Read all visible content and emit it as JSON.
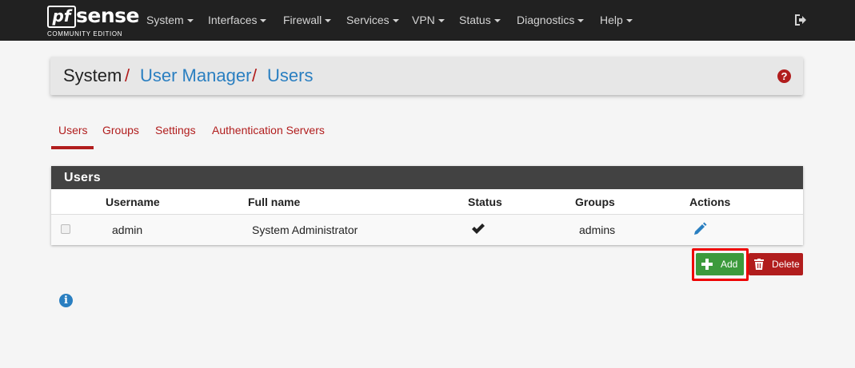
{
  "navbar": {
    "logo_pf": "pf",
    "logo_sense": "sense",
    "logo_edition": "COMMUNITY EDITION",
    "items": [
      {
        "label": "System"
      },
      {
        "label": "Interfaces"
      },
      {
        "label": "Firewall"
      },
      {
        "label": "Services"
      },
      {
        "label": "VPN"
      },
      {
        "label": "Status"
      },
      {
        "label": "Diagnostics"
      },
      {
        "label": "Help"
      }
    ],
    "logout_icon": "sign-out-icon"
  },
  "breadcrumb": {
    "items": [
      "System",
      "User Manager",
      "Users"
    ],
    "separator": "/",
    "help_icon_text": "?"
  },
  "tabs": [
    {
      "label": "Users",
      "active": true
    },
    {
      "label": "Groups",
      "active": false
    },
    {
      "label": "Settings",
      "active": false
    },
    {
      "label": "Authentication Servers",
      "active": false
    }
  ],
  "users_panel": {
    "title": "Users",
    "columns": [
      "Username",
      "Full name",
      "Status",
      "Groups",
      "Actions"
    ],
    "rows": [
      {
        "username": "admin",
        "full_name": "System Administrator",
        "status_icon": "check-icon",
        "groups": "admins",
        "action_icon": "pencil-icon"
      }
    ]
  },
  "buttons": {
    "add_label": "Add",
    "delete_label": "Delete"
  },
  "info_icon_text": "i",
  "colors": {
    "navbar_bg": "#212121",
    "accent_red": "#b11d1d",
    "link_blue": "#2a7fc1",
    "add_green": "#3c9a3c",
    "highlight_red": "#ee0000"
  }
}
